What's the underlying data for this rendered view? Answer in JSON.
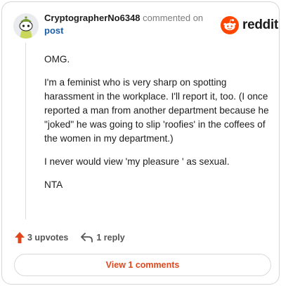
{
  "comment": {
    "username": "CryptographerNo6348",
    "action_text": "commented on",
    "target_link": "post"
  },
  "brand": {
    "name": "reddit",
    "accent": "#FF4500"
  },
  "body": {
    "paragraphs": [
      "OMG.",
      "I'm a feminist who is very sharp on spotting harassment in the workplace. I'll report it, too. (I once reported a man from another department because he \"joked\" he was going to slip 'roofies' in the coffees of the women in my department.)",
      "I never would view 'my pleasure ' as sexual.",
      "NTA"
    ]
  },
  "actions": {
    "upvotes": "3 upvotes",
    "reply": "1 reply",
    "upvote_color": "#E0471C"
  },
  "view_button": {
    "label": "View 1 comments"
  },
  "icons": [
    "avatar-snoo",
    "reddit-logo-icon",
    "upvote-arrow-icon",
    "reply-arrow-icon"
  ]
}
